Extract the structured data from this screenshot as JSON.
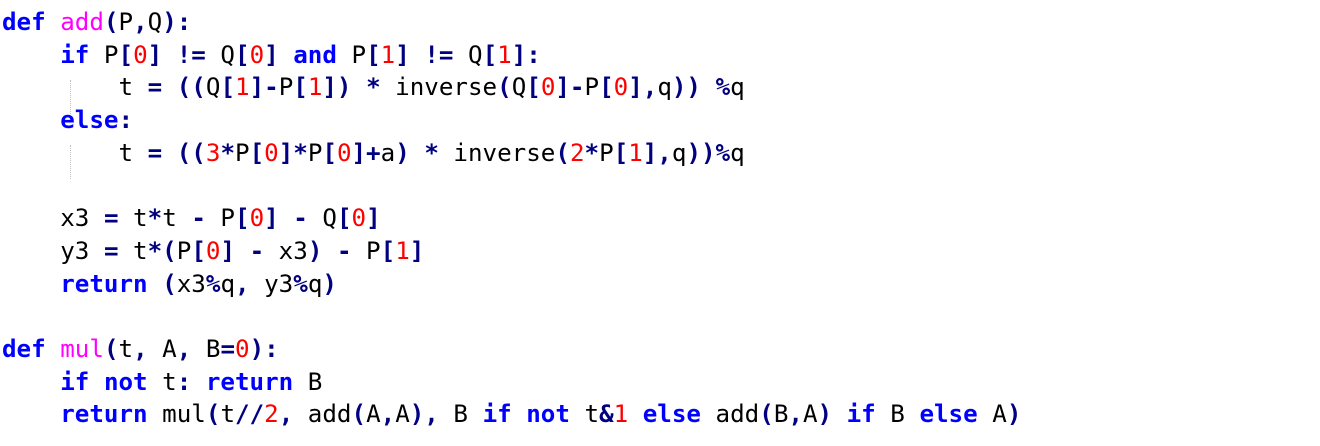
{
  "lines": [
    [
      [
        "kw",
        "def"
      ],
      [
        "tx",
        " "
      ],
      [
        "fn",
        "add"
      ],
      [
        "op",
        "("
      ],
      [
        "tx",
        "P"
      ],
      [
        "op",
        ","
      ],
      [
        "tx",
        "Q"
      ],
      [
        "op",
        "):"
      ]
    ],
    [
      [
        "tx",
        "    "
      ],
      [
        "kw",
        "if"
      ],
      [
        "tx",
        " P"
      ],
      [
        "op",
        "["
      ],
      [
        "num",
        "0"
      ],
      [
        "op",
        "]"
      ],
      [
        "tx",
        " "
      ],
      [
        "op",
        "!="
      ],
      [
        "tx",
        " Q"
      ],
      [
        "op",
        "["
      ],
      [
        "num",
        "0"
      ],
      [
        "op",
        "]"
      ],
      [
        "tx",
        " "
      ],
      [
        "kw",
        "and"
      ],
      [
        "tx",
        " P"
      ],
      [
        "op",
        "["
      ],
      [
        "num",
        "1"
      ],
      [
        "op",
        "]"
      ],
      [
        "tx",
        " "
      ],
      [
        "op",
        "!="
      ],
      [
        "tx",
        " Q"
      ],
      [
        "op",
        "["
      ],
      [
        "num",
        "1"
      ],
      [
        "op",
        "]:"
      ]
    ],
    [
      [
        "tx",
        "        t "
      ],
      [
        "op",
        "="
      ],
      [
        "tx",
        " "
      ],
      [
        "op",
        "(("
      ],
      [
        "tx",
        "Q"
      ],
      [
        "op",
        "["
      ],
      [
        "num",
        "1"
      ],
      [
        "op",
        "]-"
      ],
      [
        "tx",
        "P"
      ],
      [
        "op",
        "["
      ],
      [
        "num",
        "1"
      ],
      [
        "op",
        "])"
      ],
      [
        "tx",
        " "
      ],
      [
        "op",
        "*"
      ],
      [
        "tx",
        " inverse"
      ],
      [
        "op",
        "("
      ],
      [
        "tx",
        "Q"
      ],
      [
        "op",
        "["
      ],
      [
        "num",
        "0"
      ],
      [
        "op",
        "]-"
      ],
      [
        "tx",
        "P"
      ],
      [
        "op",
        "["
      ],
      [
        "num",
        "0"
      ],
      [
        "op",
        "],"
      ],
      [
        "tx",
        "q"
      ],
      [
        "op",
        "))"
      ],
      [
        "tx",
        " "
      ],
      [
        "op",
        "%"
      ],
      [
        "tx",
        "q"
      ]
    ],
    [
      [
        "tx",
        "    "
      ],
      [
        "kw",
        "else"
      ],
      [
        "op",
        ":"
      ]
    ],
    [
      [
        "tx",
        "        t "
      ],
      [
        "op",
        "="
      ],
      [
        "tx",
        " "
      ],
      [
        "op",
        "(("
      ],
      [
        "num",
        "3"
      ],
      [
        "op",
        "*"
      ],
      [
        "tx",
        "P"
      ],
      [
        "op",
        "["
      ],
      [
        "num",
        "0"
      ],
      [
        "op",
        "]*"
      ],
      [
        "tx",
        "P"
      ],
      [
        "op",
        "["
      ],
      [
        "num",
        "0"
      ],
      [
        "op",
        "]+"
      ],
      [
        "tx",
        "a"
      ],
      [
        "op",
        ")"
      ],
      [
        "tx",
        " "
      ],
      [
        "op",
        "*"
      ],
      [
        "tx",
        " inverse"
      ],
      [
        "op",
        "("
      ],
      [
        "num",
        "2"
      ],
      [
        "op",
        "*"
      ],
      [
        "tx",
        "P"
      ],
      [
        "op",
        "["
      ],
      [
        "num",
        "1"
      ],
      [
        "op",
        "],"
      ],
      [
        "tx",
        "q"
      ],
      [
        "op",
        "))%"
      ],
      [
        "tx",
        "q"
      ]
    ],
    [],
    [
      [
        "tx",
        "    x3 "
      ],
      [
        "op",
        "="
      ],
      [
        "tx",
        " t"
      ],
      [
        "op",
        "*"
      ],
      [
        "tx",
        "t "
      ],
      [
        "op",
        "-"
      ],
      [
        "tx",
        " P"
      ],
      [
        "op",
        "["
      ],
      [
        "num",
        "0"
      ],
      [
        "op",
        "]"
      ],
      [
        "tx",
        " "
      ],
      [
        "op",
        "-"
      ],
      [
        "tx",
        " Q"
      ],
      [
        "op",
        "["
      ],
      [
        "num",
        "0"
      ],
      [
        "op",
        "]"
      ]
    ],
    [
      [
        "tx",
        "    y3 "
      ],
      [
        "op",
        "="
      ],
      [
        "tx",
        " t"
      ],
      [
        "op",
        "*("
      ],
      [
        "tx",
        "P"
      ],
      [
        "op",
        "["
      ],
      [
        "num",
        "0"
      ],
      [
        "op",
        "]"
      ],
      [
        "tx",
        " "
      ],
      [
        "op",
        "-"
      ],
      [
        "tx",
        " x3"
      ],
      [
        "op",
        ")"
      ],
      [
        "tx",
        " "
      ],
      [
        "op",
        "-"
      ],
      [
        "tx",
        " P"
      ],
      [
        "op",
        "["
      ],
      [
        "num",
        "1"
      ],
      [
        "op",
        "]"
      ]
    ],
    [
      [
        "tx",
        "    "
      ],
      [
        "kw",
        "return"
      ],
      [
        "tx",
        " "
      ],
      [
        "op",
        "("
      ],
      [
        "tx",
        "x3"
      ],
      [
        "op",
        "%"
      ],
      [
        "tx",
        "q"
      ],
      [
        "op",
        ","
      ],
      [
        "tx",
        " y3"
      ],
      [
        "op",
        "%"
      ],
      [
        "tx",
        "q"
      ],
      [
        "op",
        ")"
      ]
    ],
    [],
    [
      [
        "kw",
        "def"
      ],
      [
        "tx",
        " "
      ],
      [
        "fn",
        "mul"
      ],
      [
        "op",
        "("
      ],
      [
        "tx",
        "t"
      ],
      [
        "op",
        ","
      ],
      [
        "tx",
        " A"
      ],
      [
        "op",
        ","
      ],
      [
        "tx",
        " B"
      ],
      [
        "op",
        "="
      ],
      [
        "num",
        "0"
      ],
      [
        "op",
        "):"
      ]
    ],
    [
      [
        "tx",
        "    "
      ],
      [
        "kw",
        "if"
      ],
      [
        "tx",
        " "
      ],
      [
        "kw",
        "not"
      ],
      [
        "tx",
        " t"
      ],
      [
        "op",
        ":"
      ],
      [
        "tx",
        " "
      ],
      [
        "kw",
        "return"
      ],
      [
        "tx",
        " B"
      ]
    ],
    [
      [
        "tx",
        "    "
      ],
      [
        "kw",
        "return"
      ],
      [
        "tx",
        " mul"
      ],
      [
        "op",
        "("
      ],
      [
        "tx",
        "t"
      ],
      [
        "op",
        "//"
      ],
      [
        "num",
        "2"
      ],
      [
        "op",
        ","
      ],
      [
        "tx",
        " add"
      ],
      [
        "op",
        "("
      ],
      [
        "tx",
        "A"
      ],
      [
        "op",
        ","
      ],
      [
        "tx",
        "A"
      ],
      [
        "op",
        "),"
      ],
      [
        "tx",
        " B "
      ],
      [
        "kw",
        "if"
      ],
      [
        "tx",
        " "
      ],
      [
        "kw",
        "not"
      ],
      [
        "tx",
        " t"
      ],
      [
        "op",
        "&"
      ],
      [
        "num",
        "1"
      ],
      [
        "tx",
        " "
      ],
      [
        "kw",
        "else"
      ],
      [
        "tx",
        " add"
      ],
      [
        "op",
        "("
      ],
      [
        "tx",
        "B"
      ],
      [
        "op",
        ","
      ],
      [
        "tx",
        "A"
      ],
      [
        "op",
        ")"
      ],
      [
        "tx",
        " "
      ],
      [
        "kw",
        "if"
      ],
      [
        "tx",
        " B "
      ],
      [
        "kw",
        "else"
      ],
      [
        "tx",
        " A"
      ],
      [
        "op",
        ")"
      ]
    ]
  ]
}
